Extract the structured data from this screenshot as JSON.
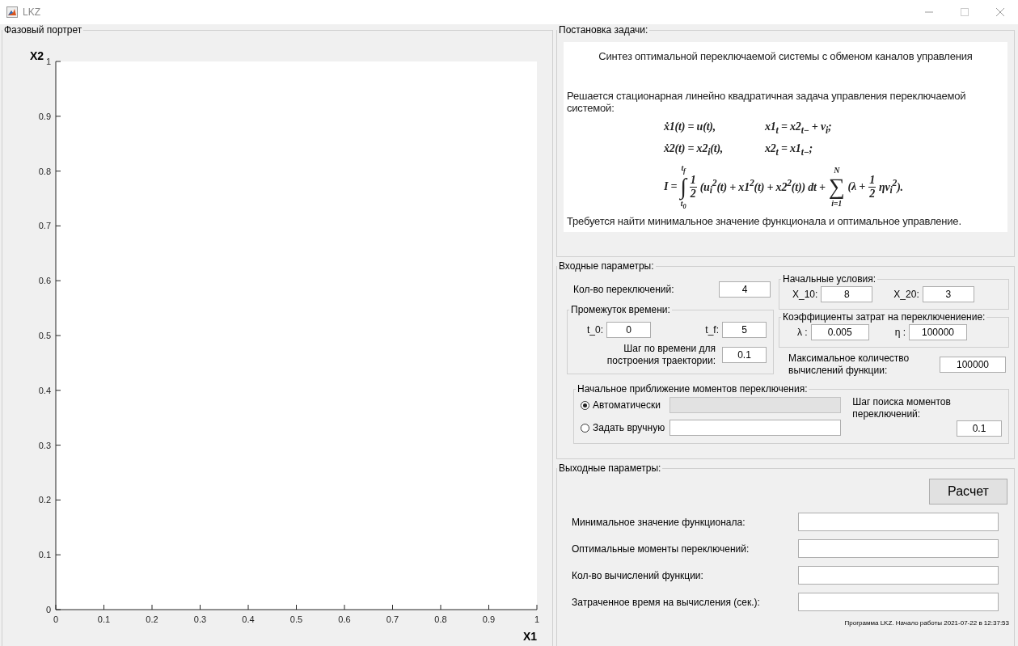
{
  "window": {
    "title": "LKZ"
  },
  "phase_portrait": {
    "title": "Фазовый портрет",
    "chart_data": {
      "type": "line",
      "xlabel": "X1",
      "ylabel": "X2",
      "xlim": [
        0,
        1
      ],
      "ylim": [
        0,
        1
      ],
      "xticks": [
        0,
        0.1,
        0.2,
        0.3,
        0.4,
        0.5,
        0.6,
        0.7,
        0.8,
        0.9,
        1
      ],
      "yticks": [
        0,
        0.1,
        0.2,
        0.3,
        0.4,
        0.5,
        0.6,
        0.7,
        0.8,
        0.9,
        1
      ]
    }
  },
  "problem": {
    "title": "Постановка задачи:",
    "heading": "Синтез оптимальной переключаемой системы с обменом каналов управления",
    "intro": "Решается стационарная линейно квадратичная задача управления переключаемой системой:",
    "equations": [
      [
        "ẋ1(t) = u(t),",
        "x1$_{t}$ = x2$_{t−}$ + v$_{i}$;"
      ],
      [
        "ẋ2(t) = x2$_{i}$(t),",
        "x2$_{t}$ = x1$_{t−}$;"
      ]
    ],
    "functional": [
      {
        "kind": "text",
        "text": "I ="
      },
      {
        "kind": "limits",
        "sign": "∫",
        "upper": "t$_{f}$",
        "lower": "t$_{0}$"
      },
      {
        "kind": "frac",
        "num": "1",
        "den": "2"
      },
      {
        "kind": "text",
        "text": "(u$_{i}$$^{2}$(t) + x1$^{2}$(t) + x2$^{2}$(t)) dt +"
      },
      {
        "kind": "limits",
        "sign": "∑",
        "upper": "N",
        "lower": "i=1"
      },
      {
        "kind": "text",
        "text": "(λ +"
      },
      {
        "kind": "frac",
        "num": "1",
        "den": "2"
      },
      {
        "kind": "text",
        "text": "ηv$_{i}$$^{2}$)."
      }
    ],
    "conclusion": "Требуется найти минимальное значение функционала и оптимальное управление."
  },
  "inputs": {
    "title": "Входные параметры:",
    "switch_count": {
      "label": "Кол-во переключений:",
      "value": "4"
    },
    "time_interval": {
      "title": "Промежуток времени:",
      "t0": {
        "label": "t_0:",
        "value": "0"
      },
      "tf": {
        "label": "t_f:",
        "value": "5"
      },
      "step": {
        "label": "Шаг по времени для построения траектории:",
        "value": "0.1"
      }
    },
    "initial_conditions": {
      "title": "Начальные условия:",
      "x10": {
        "label": "X_10:",
        "value": "8"
      },
      "x20": {
        "label": "X_20:",
        "value": "3"
      }
    },
    "costs": {
      "title": "Коэффициенты затрат на переключениение:",
      "lambda": {
        "label": "λ :",
        "value": "0.005"
      },
      "eta": {
        "label": "η :",
        "value": "100000"
      }
    },
    "max_evals": {
      "label": "Максимальное количество вычислений функции:",
      "value": "100000"
    },
    "initial_guess": {
      "title": "Начальное приближение моментов переключения:",
      "options": [
        {
          "label": "Автоматически",
          "selected": true,
          "field_disabled": true
        },
        {
          "label": "Задать вручную",
          "selected": false,
          "field_disabled": false
        }
      ],
      "search_step": {
        "label": "Шаг поиска моментов переключений:",
        "value": "0.1"
      }
    }
  },
  "outputs": {
    "title": "Выходные параметры:",
    "button": "Расчет",
    "rows": [
      {
        "label": "Минимальное значение функционала:"
      },
      {
        "label": "Оптимальные моменты переключений:"
      },
      {
        "label": "Кол-во вычислений функции:"
      },
      {
        "label": "Затраченное время на вычисления (сек.):"
      }
    ],
    "footer": "Программа LKZ. Начало работы 2021-07-22 в 12:37:53"
  }
}
